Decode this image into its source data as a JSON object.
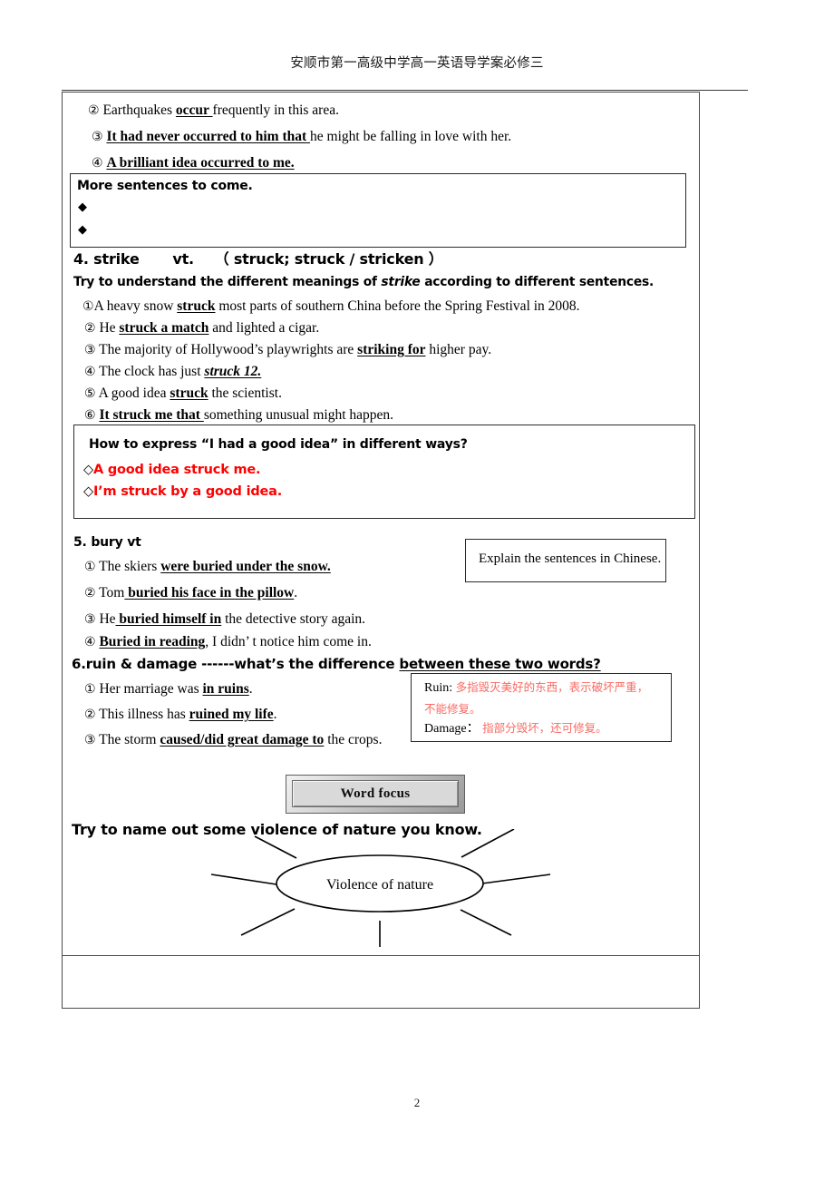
{
  "header": {
    "title": "安顺市第一高级中学高一英语导学案必修三"
  },
  "page_number": "2",
  "colors": {
    "red_bullet_text": "#ff0000",
    "chinese_note_text": "#fa6a62",
    "border": "#2b2b2b"
  },
  "occur_items": [
    {
      "marker": "②",
      "pre": "Earthquakes ",
      "bold": "occur ",
      "post": "frequently in this area."
    },
    {
      "marker": "③",
      "pre": "",
      "bold": "It had never occurred to him that ",
      "post": "he might be falling in love with her."
    },
    {
      "marker": "④",
      "pre": "",
      "bold": "A brilliant idea occurred to me.",
      "post": ""
    }
  ],
  "more_box": {
    "title": "More sentences to come.",
    "bullets": [
      "◆",
      "◆"
    ]
  },
  "strike": {
    "heading_num": "4. strike",
    "heading_pos": "vt.",
    "heading_forms": "（ struck; struck / stricken ）",
    "instruction_pre": "Try to understand the different meanings of ",
    "instruction_word": "strike",
    "instruction_post": " according to different sentences.",
    "items": [
      {
        "marker": "①",
        "pre": "A heavy snow ",
        "bold": "struck",
        "post": " most parts of southern China before the Spring Festival in 2008."
      },
      {
        "marker": "②",
        "pre": "He ",
        "bold": "struck a match",
        "post": " and lighted a cigar."
      },
      {
        "marker": "③",
        "pre": "The majority of Hollywood’s playwrights are ",
        "bold": "striking for",
        "post": " higher pay."
      },
      {
        "marker": "④",
        "pre": "The clock has just ",
        "bold": "struck 12.",
        "post": "",
        "italic": true
      },
      {
        "marker": "⑤",
        "pre": "A good idea ",
        "bold": "struck",
        "post": " the scientist."
      },
      {
        "marker": "⑥",
        "pre": "",
        "bold": "It struck me that ",
        "post": "something unusual might happen."
      }
    ]
  },
  "express_box": {
    "question": "How to express “I had a good idea” in different ways?",
    "answers": [
      {
        "bullet": "◇",
        "text": "A good idea struck me."
      },
      {
        "bullet": "◇",
        "text": "I’m struck by a good idea."
      }
    ]
  },
  "bury": {
    "heading": "5. bury   vt",
    "items": [
      {
        "marker": "①",
        "pre": "The skiers ",
        "bold": "were buried under the snow.",
        "post": ""
      },
      {
        "marker": "②",
        "pre": "Tom",
        "bold": " buried his face in the pillow",
        "post": "."
      },
      {
        "marker": "③",
        "pre": "He",
        "bold": " buried himself in",
        "post": " the detective story again."
      },
      {
        "marker": "④",
        "pre": "",
        "bold": "Buried in reading",
        "post": ", I didn’ t notice him come in."
      }
    ],
    "explain_box": "Explain the sentences in Chinese."
  },
  "ruin": {
    "heading_pre": "6.ruin & damage   ------what’s the difference ",
    "heading_underlined": "between these two words?",
    "items": [
      {
        "marker": "①",
        "pre": "Her marriage was ",
        "bold": "in ruins",
        "post": "."
      },
      {
        "marker": "②",
        "pre": "This illness has ",
        "bold": "ruined my life",
        "post": "."
      },
      {
        "marker": "③",
        "pre": "The storm ",
        "bold": "caused/did great damage to",
        "post": " the crops."
      }
    ],
    "note_box": {
      "ruin_label": "Ruin:",
      "ruin_text_line1": "多指毁灭美好的东西，表示破坏严重，",
      "ruin_text_line2": "不能修复。",
      "damage_label": "Damage：",
      "damage_text": "指部分毁坏，还可修复。"
    }
  },
  "word_focus": {
    "label": "Word focus"
  },
  "violence": {
    "prompt": "Try to name out some violence of nature you know.",
    "center_label": "Violence of nature"
  }
}
